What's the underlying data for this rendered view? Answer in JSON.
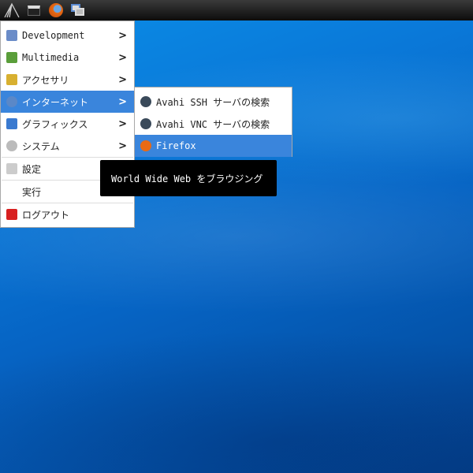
{
  "taskbar": {
    "icons": [
      "lxde-menu-icon",
      "terminal-icon",
      "firefox-icon",
      "window-switch-icon"
    ]
  },
  "menu": {
    "items": [
      {
        "label": "Development",
        "icon": "development-icon",
        "submenu": true
      },
      {
        "label": "Multimedia",
        "icon": "multimedia-icon",
        "submenu": true
      },
      {
        "label": "アクセサリ",
        "icon": "accessories-icon",
        "submenu": true
      },
      {
        "label": "インターネット",
        "icon": "internet-icon",
        "submenu": true,
        "highlighted": true
      },
      {
        "label": "グラフィックス",
        "icon": "graphics-icon",
        "submenu": true
      },
      {
        "label": "システム",
        "icon": "system-icon",
        "submenu": true
      },
      {
        "label": "設定",
        "icon": "settings-icon"
      },
      {
        "label": "実行",
        "icon": ""
      },
      {
        "label": "ログアウト",
        "icon": "logout-icon"
      }
    ],
    "arrow": ">"
  },
  "submenu": {
    "items": [
      {
        "label": "Avahi SSH サーバの検索",
        "icon": "avahi-icon"
      },
      {
        "label": "Avahi VNC サーバの検索",
        "icon": "avahi-icon"
      },
      {
        "label": "Firefox",
        "icon": "firefox-icon",
        "highlighted": true
      }
    ]
  },
  "tooltip": {
    "text": "World Wide Web をブラウジング"
  },
  "colors": {
    "highlight": "#3a85dc",
    "desktop": "#0a78d8"
  }
}
